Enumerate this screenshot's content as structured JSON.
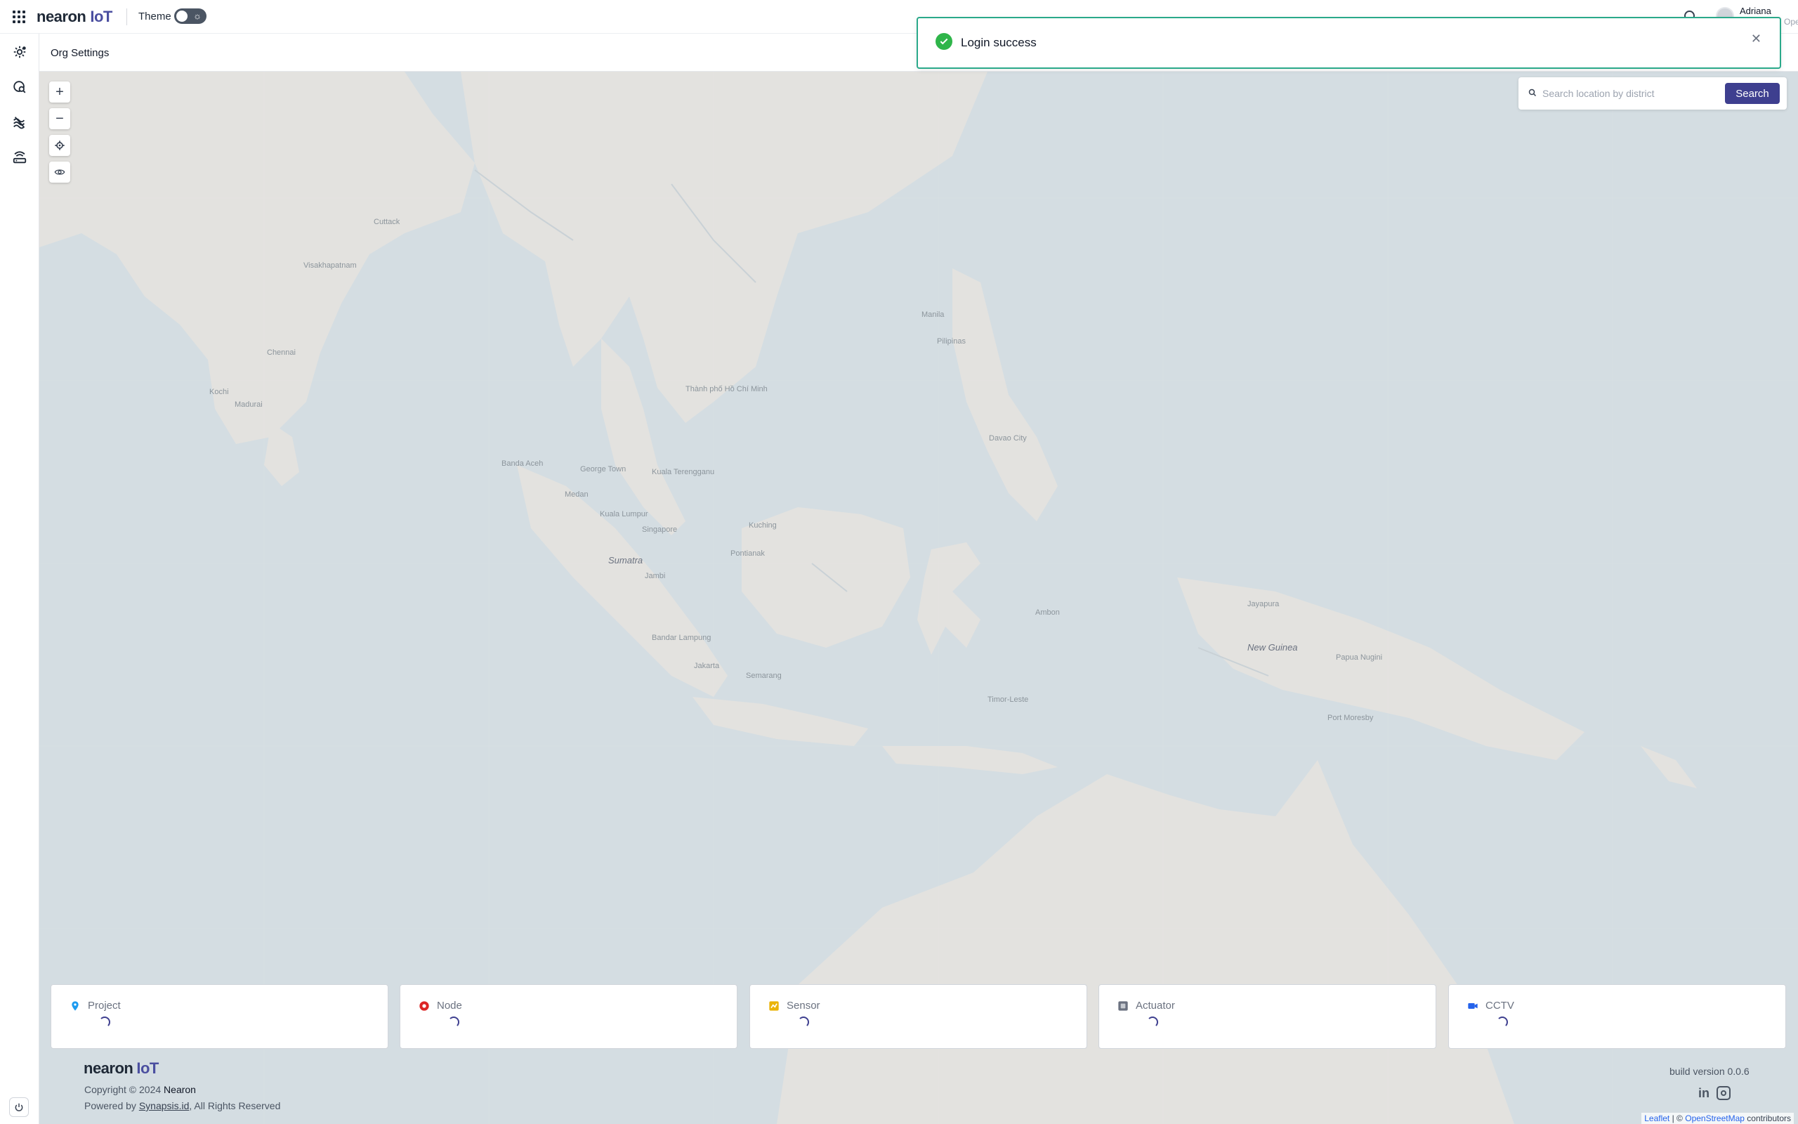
{
  "header": {
    "logo_brand": "nearon",
    "logo_suffix": "IoT",
    "theme_label": "Theme",
    "user_name": "Adriana",
    "user_role": "Operator"
  },
  "subheader": {
    "title": "Org Settings"
  },
  "toast": {
    "message": "Login success"
  },
  "map_search": {
    "placeholder": "Search location by district",
    "button": "Search"
  },
  "map_labels": [
    {
      "text": "Sumatra",
      "major": true
    },
    {
      "text": "New Guinea",
      "major": true
    },
    {
      "text": "Jayapura"
    },
    {
      "text": "Papua Nugini"
    },
    {
      "text": "Ambon"
    },
    {
      "text": "Timor-Leste"
    },
    {
      "text": "Jakarta"
    },
    {
      "text": "Semarang"
    },
    {
      "text": "Bandar Lampung"
    },
    {
      "text": "Kuching"
    },
    {
      "text": "Pontianak"
    },
    {
      "text": "Singapore"
    },
    {
      "text": "Kuala Lumpur"
    },
    {
      "text": "Kuala Terengganu"
    },
    {
      "text": "George Town"
    },
    {
      "text": "Banda Aceh"
    },
    {
      "text": "Medan"
    },
    {
      "text": "Jambi"
    },
    {
      "text": "Davao City"
    },
    {
      "text": "Manila"
    },
    {
      "text": "Pilipinas"
    },
    {
      "text": "Thành phố Hồ Chí Minh"
    },
    {
      "text": "Chennai"
    },
    {
      "text": "Madurai"
    },
    {
      "text": "Cuttack"
    },
    {
      "text": "Visakhapatnam"
    },
    {
      "text": "Port Moresby"
    },
    {
      "text": "Kochi"
    }
  ],
  "stats": [
    {
      "label": "Project",
      "icon": "map-pin-icon",
      "color": "#1d9bf0"
    },
    {
      "label": "Node",
      "icon": "node-icon",
      "color": "#dc2626"
    },
    {
      "label": "Sensor",
      "icon": "sensor-icon",
      "color": "#eab308"
    },
    {
      "label": "Actuator",
      "icon": "actuator-icon",
      "color": "#6b7280"
    },
    {
      "label": "CCTV",
      "icon": "cctv-icon",
      "color": "#2563eb"
    }
  ],
  "footer": {
    "logo_brand": "nearon",
    "logo_suffix": "IoT",
    "copyright_prefix": "Copyright © 2024",
    "copyright_company": "Nearon",
    "powered_prefix": "Powered by",
    "powered_link": "Synapsis.id",
    "powered_suffix": ", All Rights Reserved",
    "build": "build version 0.0.6"
  },
  "attribution": {
    "leaflet": "Leaflet",
    "sep": "| ©",
    "osm": "OpenStreetMap",
    "contrib": "contributors"
  },
  "colors": {
    "accent": "#3e3f8f",
    "toast_border": "#2aa98a",
    "success": "#2fb54a"
  }
}
